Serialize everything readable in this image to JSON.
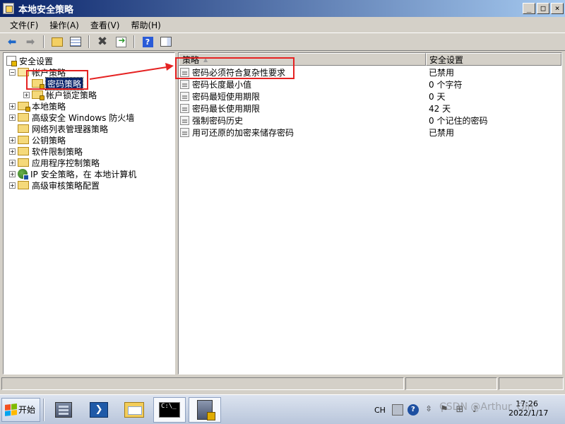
{
  "window": {
    "title": "本地安全策略"
  },
  "menu": [
    "文件(F)",
    "操作(A)",
    "查看(V)",
    "帮助(H)"
  ],
  "toolbar": {
    "icons": [
      "back-icon",
      "forward-icon",
      "up-folder-icon",
      "show-hide-tree-icon",
      "delete-icon",
      "export-list-icon",
      "help-icon",
      "properties-icon"
    ]
  },
  "tree": {
    "root": "安全设置",
    "account_policy": "帐户策略",
    "password_policy": "密码策略",
    "lockout_policy": "帐户锁定策略",
    "local_policy": "本地策略",
    "firewall": "高级安全 Windows 防火墙",
    "network_list": "网络列表管理器策略",
    "public_key": "公钥策略",
    "software_restriction": "软件限制策略",
    "app_control": "应用程序控制策略",
    "ipsec": "IP 安全策略，在 本地计算机",
    "audit": "高级审核策略配置"
  },
  "list": {
    "col_policy": "策略",
    "col_setting": "安全设置",
    "rows": [
      {
        "name": "密码必须符合复杂性要求",
        "value": "已禁用"
      },
      {
        "name": "密码长度最小值",
        "value": "0 个字符"
      },
      {
        "name": "密码最短使用期限",
        "value": "0 天"
      },
      {
        "name": "密码最长使用期限",
        "value": "42 天"
      },
      {
        "name": "强制密码历史",
        "value": "0 个记住的密码"
      },
      {
        "name": "用可还原的加密来储存密码",
        "value": "已禁用"
      }
    ]
  },
  "taskbar": {
    "start": "开始",
    "lang": "CH",
    "time": "17:26",
    "date": "2022/1/17"
  },
  "watermark": "CSDN @Arthur_Qin",
  "colors": {
    "annotation": "#e52222",
    "selection": "#0a246a"
  }
}
